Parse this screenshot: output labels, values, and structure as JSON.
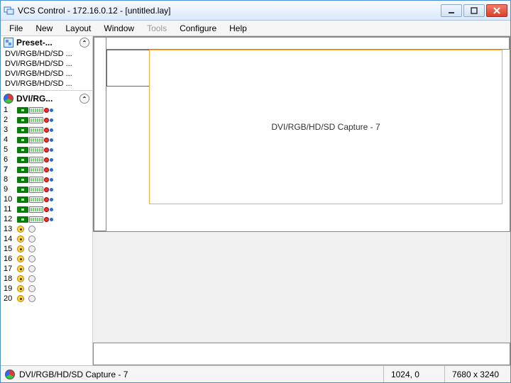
{
  "window": {
    "title": "VCS Control - 172.16.0.12 - [untitled.lay]"
  },
  "menu": {
    "file": "File",
    "new": "New",
    "layout": "Layout",
    "window": "Window",
    "tools": "Tools",
    "configure": "Configure",
    "help": "Help"
  },
  "sidebar": {
    "presets": {
      "header": "Preset-...",
      "items": [
        "DVI/RGB/HD/SD ...",
        "DVI/RGB/HD/SD ...",
        "DVI/RGB/HD/SD ...",
        "DVI/RGB/HD/SD ..."
      ]
    },
    "inputs": {
      "header": "DVI/RG...",
      "dvi": [
        "1",
        "2",
        "3",
        "4",
        "5",
        "6",
        "7",
        "8",
        "9",
        "10",
        "11",
        "12"
      ],
      "rca": [
        "13",
        "14",
        "15",
        "16",
        "17",
        "18",
        "19",
        "20"
      ],
      "selected_index": 6
    }
  },
  "canvas": {
    "capture_label": "DVI/RGB/HD/SD Capture - 7"
  },
  "status": {
    "current": "DVI/RGB/HD/SD Capture - 7",
    "coords": "1024, 0",
    "resolution": "7680 x 3240"
  }
}
